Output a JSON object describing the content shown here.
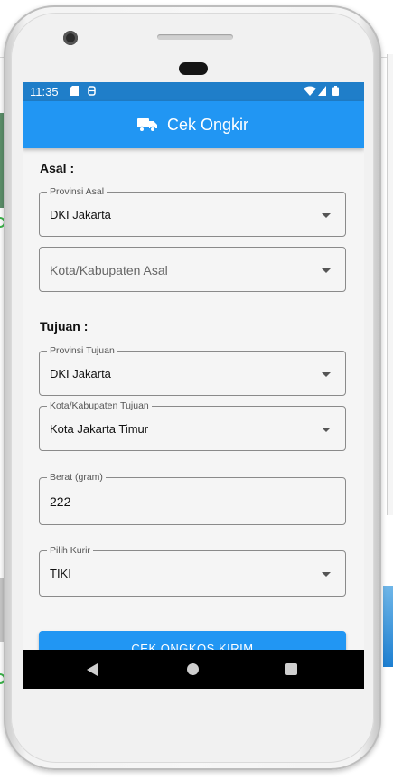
{
  "status_bar": {
    "time": "11:35",
    "icons": [
      "sd-card-icon",
      "sync-icon",
      "wifi-icon",
      "battery-icon"
    ]
  },
  "app_bar": {
    "icon": "truck-icon",
    "title": "Cek Ongkir"
  },
  "origin": {
    "label": "Asal :",
    "province": {
      "legend": "Provinsi Asal",
      "value": "DKI Jakarta"
    },
    "city": {
      "placeholder": "Kota/Kabupaten Asal"
    }
  },
  "destination": {
    "label": "Tujuan :",
    "province": {
      "legend": "Provinsi Tujuan",
      "value": "DKI Jakarta"
    },
    "city": {
      "legend": "Kota/Kabupaten Tujuan",
      "value": "Kota Jakarta Timur"
    }
  },
  "weight": {
    "legend": "Berat (gram)",
    "value": "222"
  },
  "courier": {
    "legend": "Pilih Kurir",
    "value": "TIKI"
  },
  "submit_label": "CEK ONGKOS KIRIM",
  "colors": {
    "status_bar": "#1f7ec9",
    "app_bar": "#2196f3",
    "button": "#2196f3"
  }
}
